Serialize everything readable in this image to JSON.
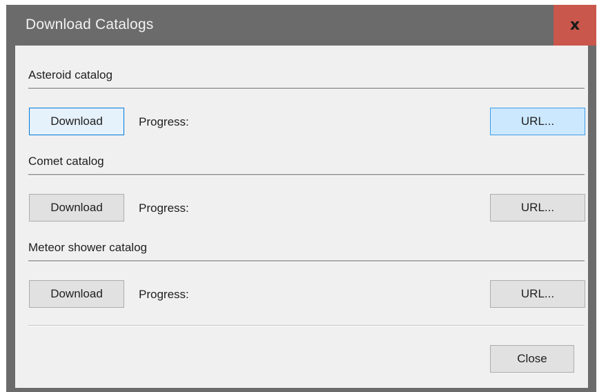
{
  "window": {
    "title": "Download Catalogs",
    "close_glyph": "x"
  },
  "sections": [
    {
      "label": "Asteroid catalog",
      "download_label": "Download",
      "progress_label": "Progress:",
      "url_label": "URL..."
    },
    {
      "label": "Comet catalog",
      "download_label": "Download",
      "progress_label": "Progress:",
      "url_label": "URL..."
    },
    {
      "label": "Meteor shower catalog",
      "download_label": "Download",
      "progress_label": "Progress:",
      "url_label": "URL..."
    }
  ],
  "footer": {
    "close_label": "Close"
  },
  "colors": {
    "titlebar": "#6b6b6b",
    "close_button": "#c9574b",
    "client_background": "#f0f0f0",
    "button_face": "#e1e1e1",
    "button_hover": "#cce8ff",
    "button_focus_border": "#0078d7"
  }
}
